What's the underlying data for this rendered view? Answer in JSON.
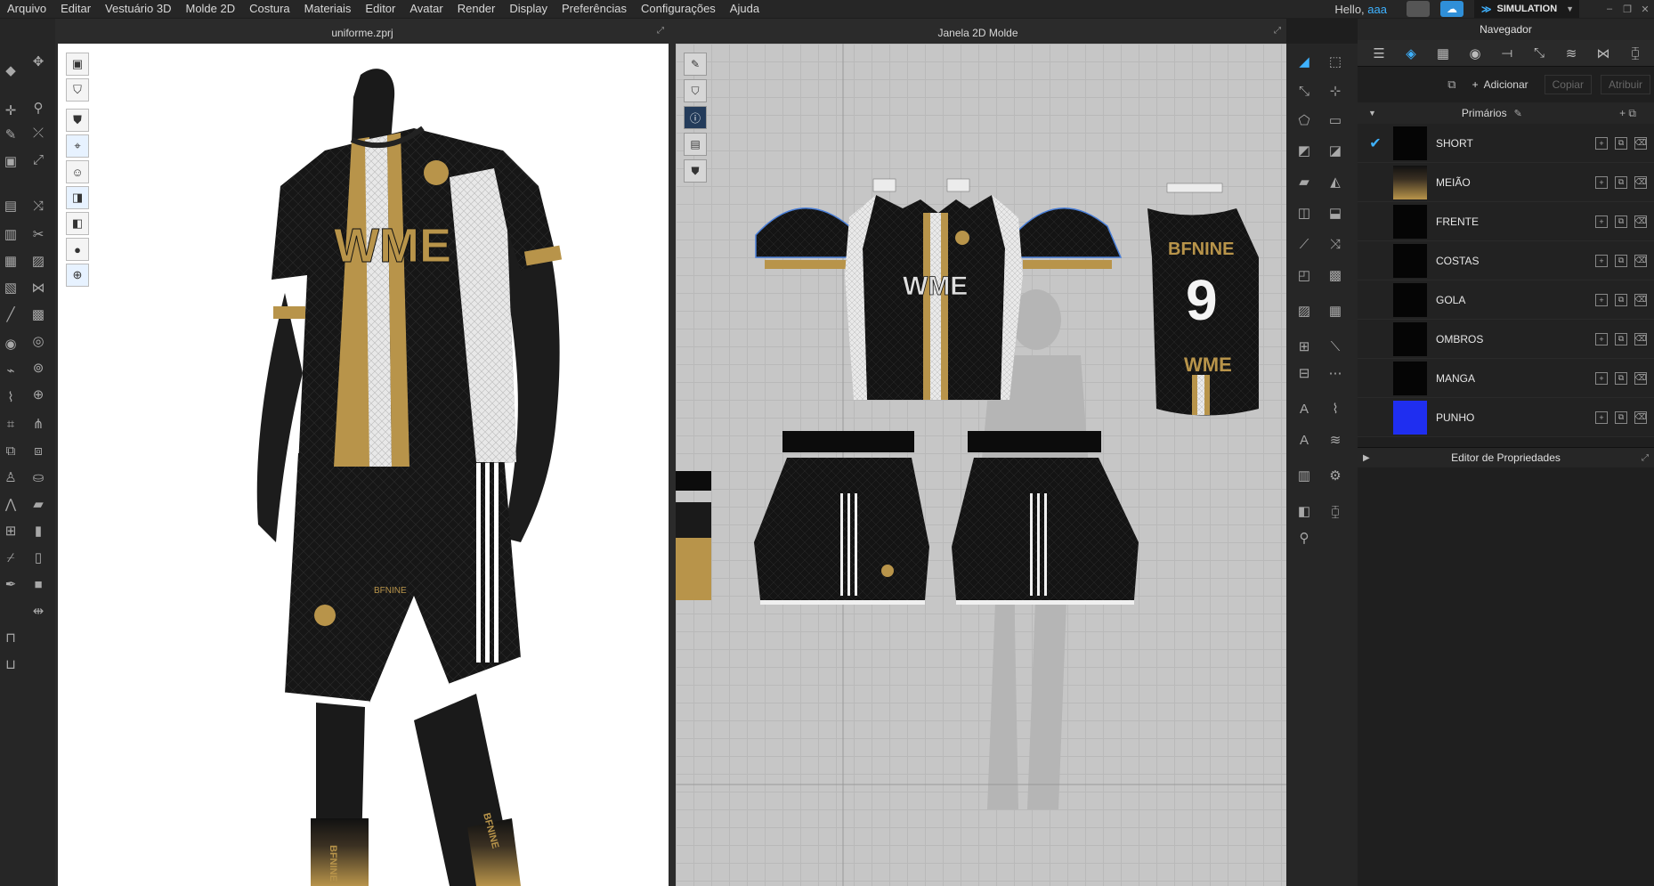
{
  "menu": {
    "items": [
      "Arquivo",
      "Editar",
      "Vestuário 3D",
      "Molde 2D",
      "Costura",
      "Materiais",
      "Editor",
      "Avatar",
      "Render",
      "Display",
      "Preferências",
      "Configurações",
      "Ajuda"
    ],
    "greeting": "Hello,",
    "username": "aaa",
    "mode": "SIMULATION"
  },
  "panel_3d": {
    "title": "uniforme.zprj",
    "jersey_text": "WME",
    "sock_text": "BFNINE"
  },
  "panel_2d": {
    "title": "Janela 2D Molde",
    "front_text": "WME",
    "back_brand": "BFNINE",
    "back_number": "9",
    "back_text": "WME"
  },
  "navigator": {
    "title": "Navegador",
    "add_label": "Adicionar",
    "copy_label": "Copiar",
    "assign_label": "Atribuir",
    "group_label": "Primários",
    "fabrics": [
      {
        "name": "SHORT",
        "selected": true,
        "swatch": "#050505"
      },
      {
        "name": "MEIÃO",
        "selected": false,
        "swatch": "gold"
      },
      {
        "name": "FRENTE",
        "selected": false,
        "swatch": "#050505"
      },
      {
        "name": "COSTAS",
        "selected": false,
        "swatch": "#050505"
      },
      {
        "name": "GOLA",
        "selected": false,
        "swatch": "#050505"
      },
      {
        "name": "OMBROS",
        "selected": false,
        "swatch": "#050505"
      },
      {
        "name": "MANGA",
        "selected": false,
        "swatch": "#050505"
      },
      {
        "name": "PUNHO",
        "selected": false,
        "swatch": "#1f2ef0"
      }
    ],
    "property_editor_title": "Editor de Propriedades"
  },
  "colors": {
    "accent": "#3fb2ff",
    "gold": "#b8944a",
    "jersey_black": "#161616",
    "cuff_blue": "#1f2ef0"
  }
}
